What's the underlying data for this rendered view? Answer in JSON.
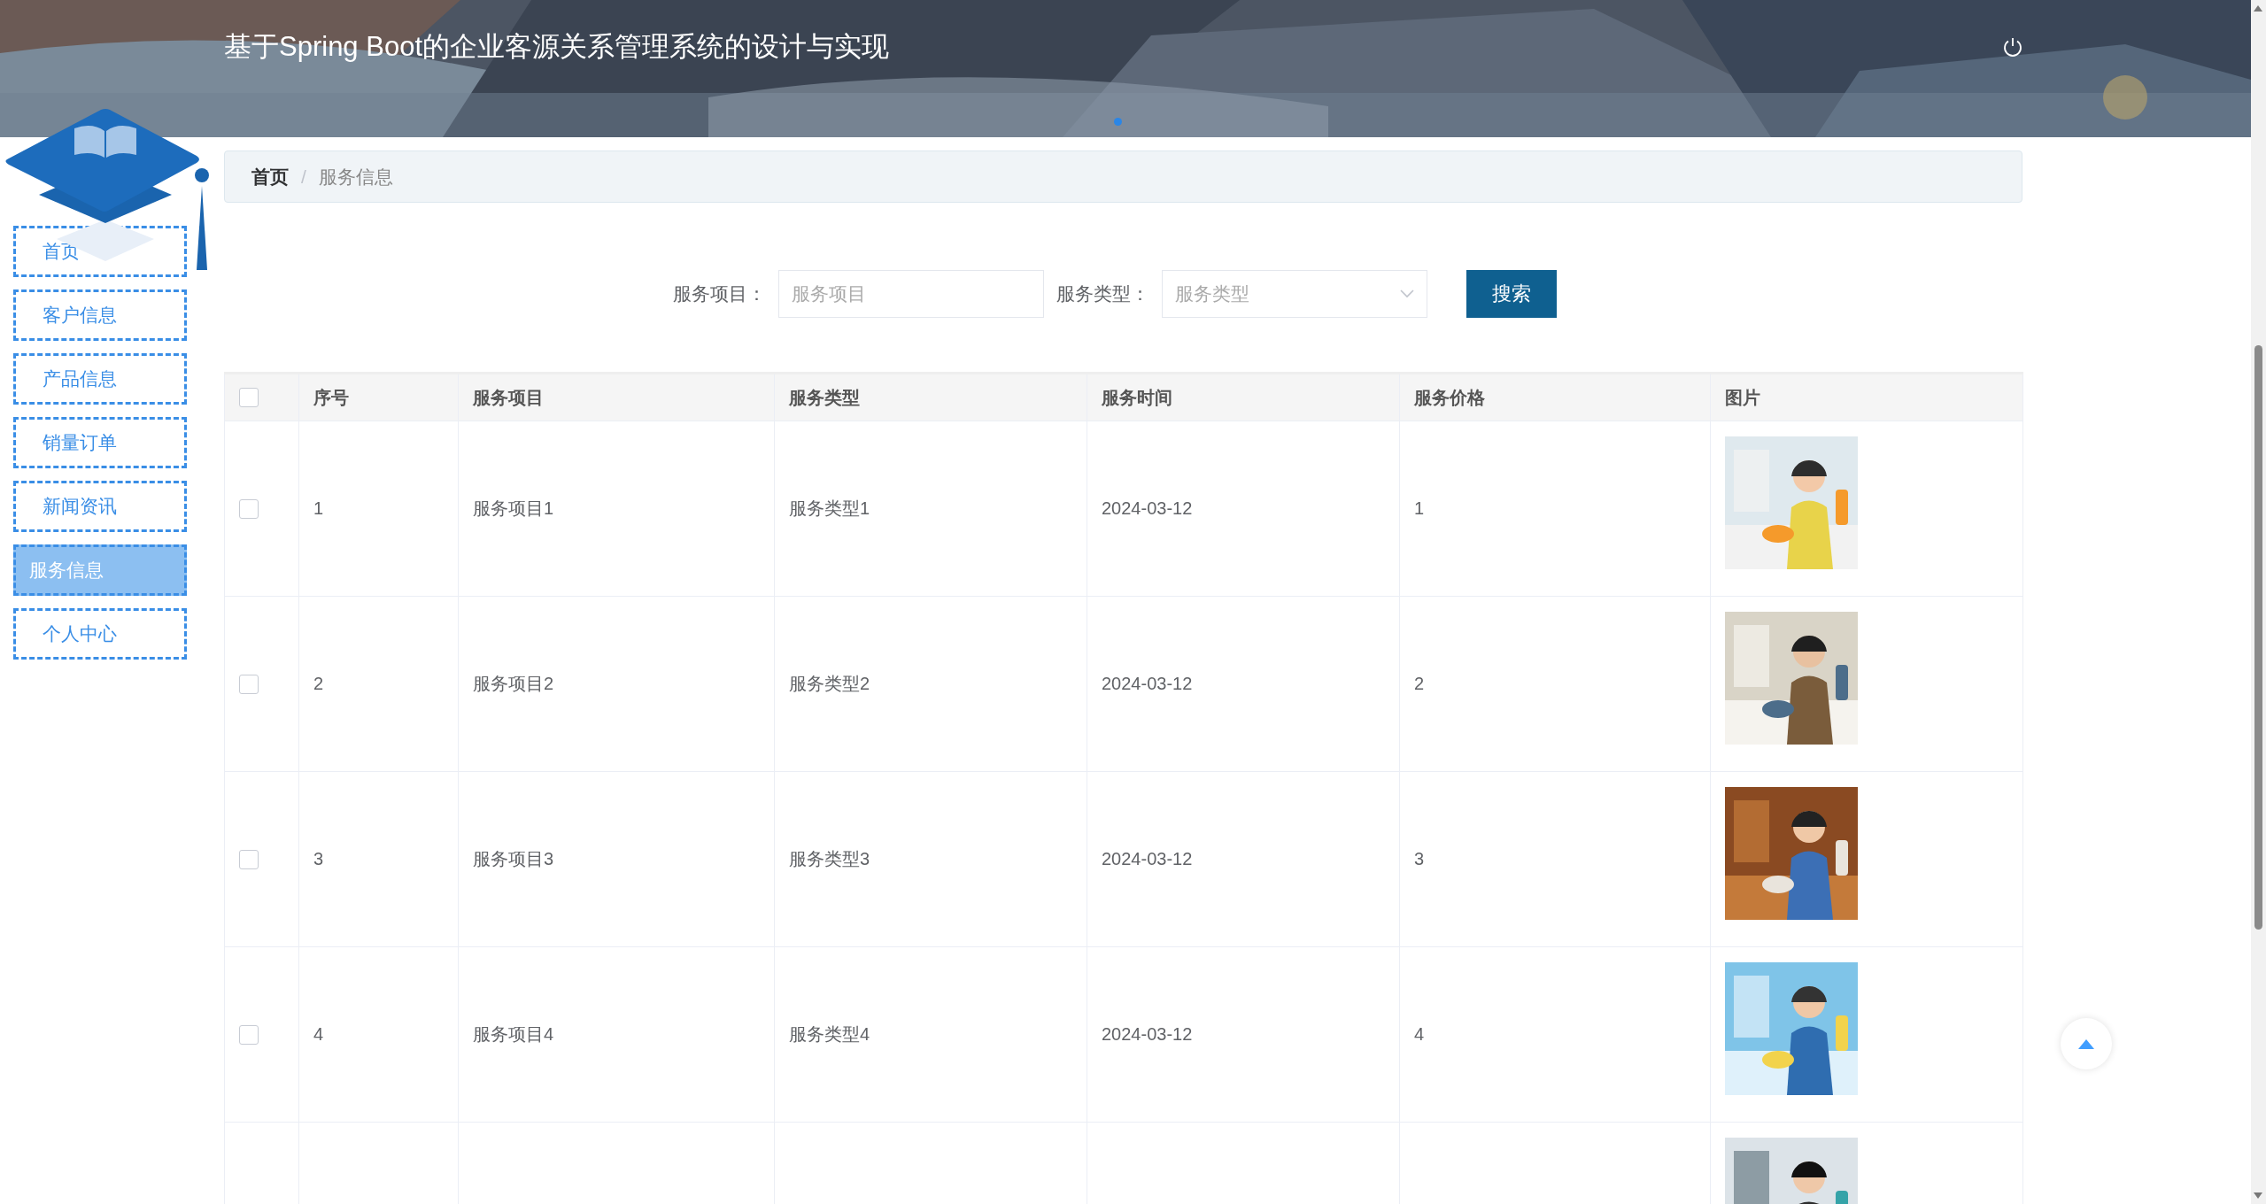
{
  "header": {
    "title": "基于Spring Boot的企业客源关系管理系统的设计与实现"
  },
  "sidebar": {
    "items": [
      {
        "label": "首页",
        "selected": false
      },
      {
        "label": "客户信息",
        "selected": false
      },
      {
        "label": "产品信息",
        "selected": false
      },
      {
        "label": "销量订单",
        "selected": false
      },
      {
        "label": "新闻资讯",
        "selected": false
      },
      {
        "label": "服务信息",
        "selected": true
      },
      {
        "label": "个人中心",
        "selected": false
      }
    ]
  },
  "breadcrumb": {
    "items": [
      "首页",
      "服务信息"
    ],
    "separator": "/"
  },
  "search": {
    "fields": [
      {
        "kind": "input",
        "label": "服务项目：",
        "placeholder": "服务项目"
      },
      {
        "kind": "select",
        "label": "服务类型：",
        "placeholder": "服务类型"
      }
    ],
    "button": "搜索"
  },
  "table": {
    "all_checked": false,
    "columns": [
      "序号",
      "服务项目",
      "服务类型",
      "服务时间",
      "服务价格",
      "图片"
    ],
    "rows": [
      {
        "checked": false,
        "cells": [
          "1",
          "服务项目1",
          "服务类型1",
          "2024-03-12",
          "1"
        ],
        "image": {
          "kind": "picture"
        }
      },
      {
        "checked": false,
        "cells": [
          "2",
          "服务项目2",
          "服务类型2",
          "2024-03-12",
          "2"
        ],
        "image": {
          "kind": "picture"
        }
      },
      {
        "checked": false,
        "cells": [
          "3",
          "服务项目3",
          "服务类型3",
          "2024-03-12",
          "3"
        ],
        "image": {
          "kind": "picture"
        }
      },
      {
        "checked": false,
        "cells": [
          "4",
          "服务项目4",
          "服务类型4",
          "2024-03-12",
          "4"
        ],
        "image": {
          "kind": "picture"
        }
      },
      {
        "image": {
          "kind": "picture"
        }
      }
    ]
  }
}
